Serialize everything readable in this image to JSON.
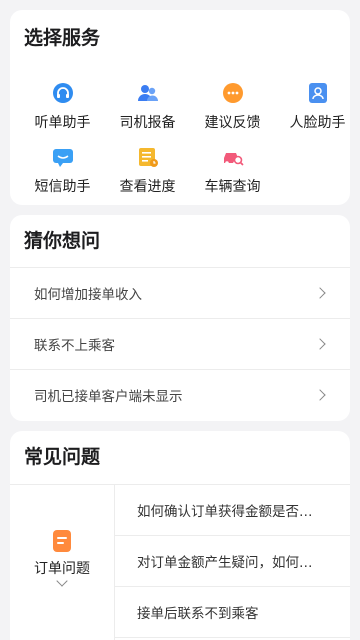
{
  "services": {
    "title": "选择服务",
    "items": [
      {
        "label": "听单助手",
        "icon": "headset-icon",
        "color": "#2f8cf0"
      },
      {
        "label": "司机报备",
        "icon": "people-icon",
        "color": "#3b7df2"
      },
      {
        "label": "建议反馈",
        "icon": "more-bubble-icon",
        "color": "#ff9a2e"
      },
      {
        "label": "人脸助手",
        "icon": "face-id-icon",
        "color": "#4a90f0"
      },
      {
        "label": "短信助手",
        "icon": "message-icon",
        "color": "#3aa0f5"
      },
      {
        "label": "查看进度",
        "icon": "progress-icon",
        "color": "#f5b82e"
      },
      {
        "label": "车辆查询",
        "icon": "car-search-icon",
        "color": "#f25a7a"
      }
    ]
  },
  "guess": {
    "title": "猜你想问",
    "questions": [
      "如何增加接单收入",
      "联系不上乘客",
      "司机已接单客户端未显示"
    ]
  },
  "faq": {
    "title": "常见问题",
    "category": "订单问题",
    "questions": [
      "如何确认订单获得金额是否…",
      "对订单金额产生疑问，如何…",
      "接单后联系不到乘客"
    ]
  }
}
